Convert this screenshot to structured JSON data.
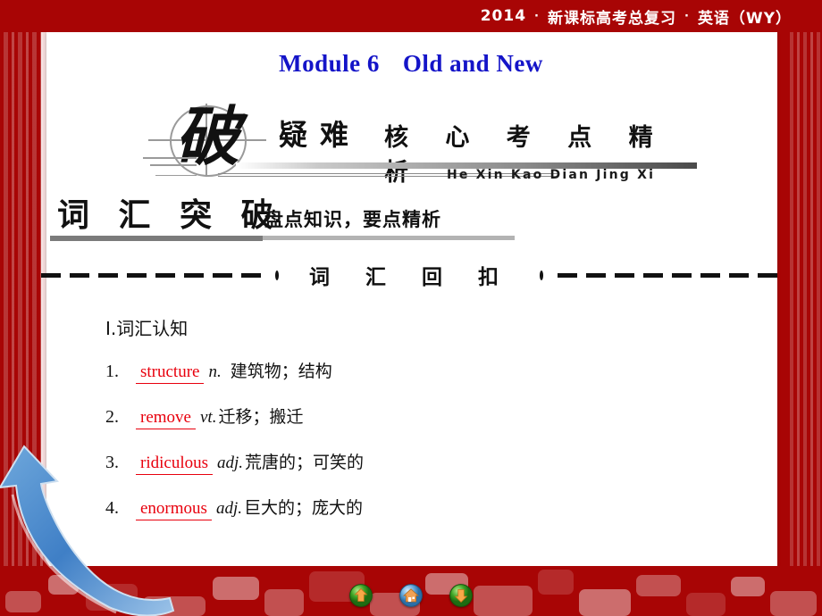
{
  "header": {
    "year": "2014",
    "separator": "·",
    "subject_cn": "新课标高考总复习",
    "edition": "英语（WY）"
  },
  "module": {
    "label": "Module 6",
    "title": "Old and New"
  },
  "banner": {
    "glyph": "破",
    "word": "疑难",
    "phrase": "核 心 考 点 精 析",
    "pinyin": "He Xin Kao Dian Jing Xi"
  },
  "section": {
    "title": "词 汇 突 破",
    "subtitle": "盘点知识，要点精析"
  },
  "divider": {
    "label": "词 汇 回 扣"
  },
  "vocabulary": {
    "heading": "Ⅰ.词汇认知",
    "items": [
      {
        "num": "1.",
        "word": "structure",
        "pos": "n.",
        "definition": "建筑物；结构"
      },
      {
        "num": "2.",
        "word": "remove",
        "pos": "vt.",
        "definition": "迁移；搬迁"
      },
      {
        "num": "3.",
        "word": "ridiculous",
        "pos": "adj.",
        "definition": "荒唐的；可笑的"
      },
      {
        "num": "4.",
        "word": "enormous",
        "pos": "adj.",
        "definition": "巨大的；庞大的"
      }
    ]
  },
  "nav": {
    "prev_label": "上一页",
    "home_label": "主页",
    "next_label": "下一页"
  },
  "colors": {
    "frame_red": "#a80505",
    "title_blue": "#1414c8",
    "word_red": "#e8000d",
    "ink": "#111111"
  }
}
